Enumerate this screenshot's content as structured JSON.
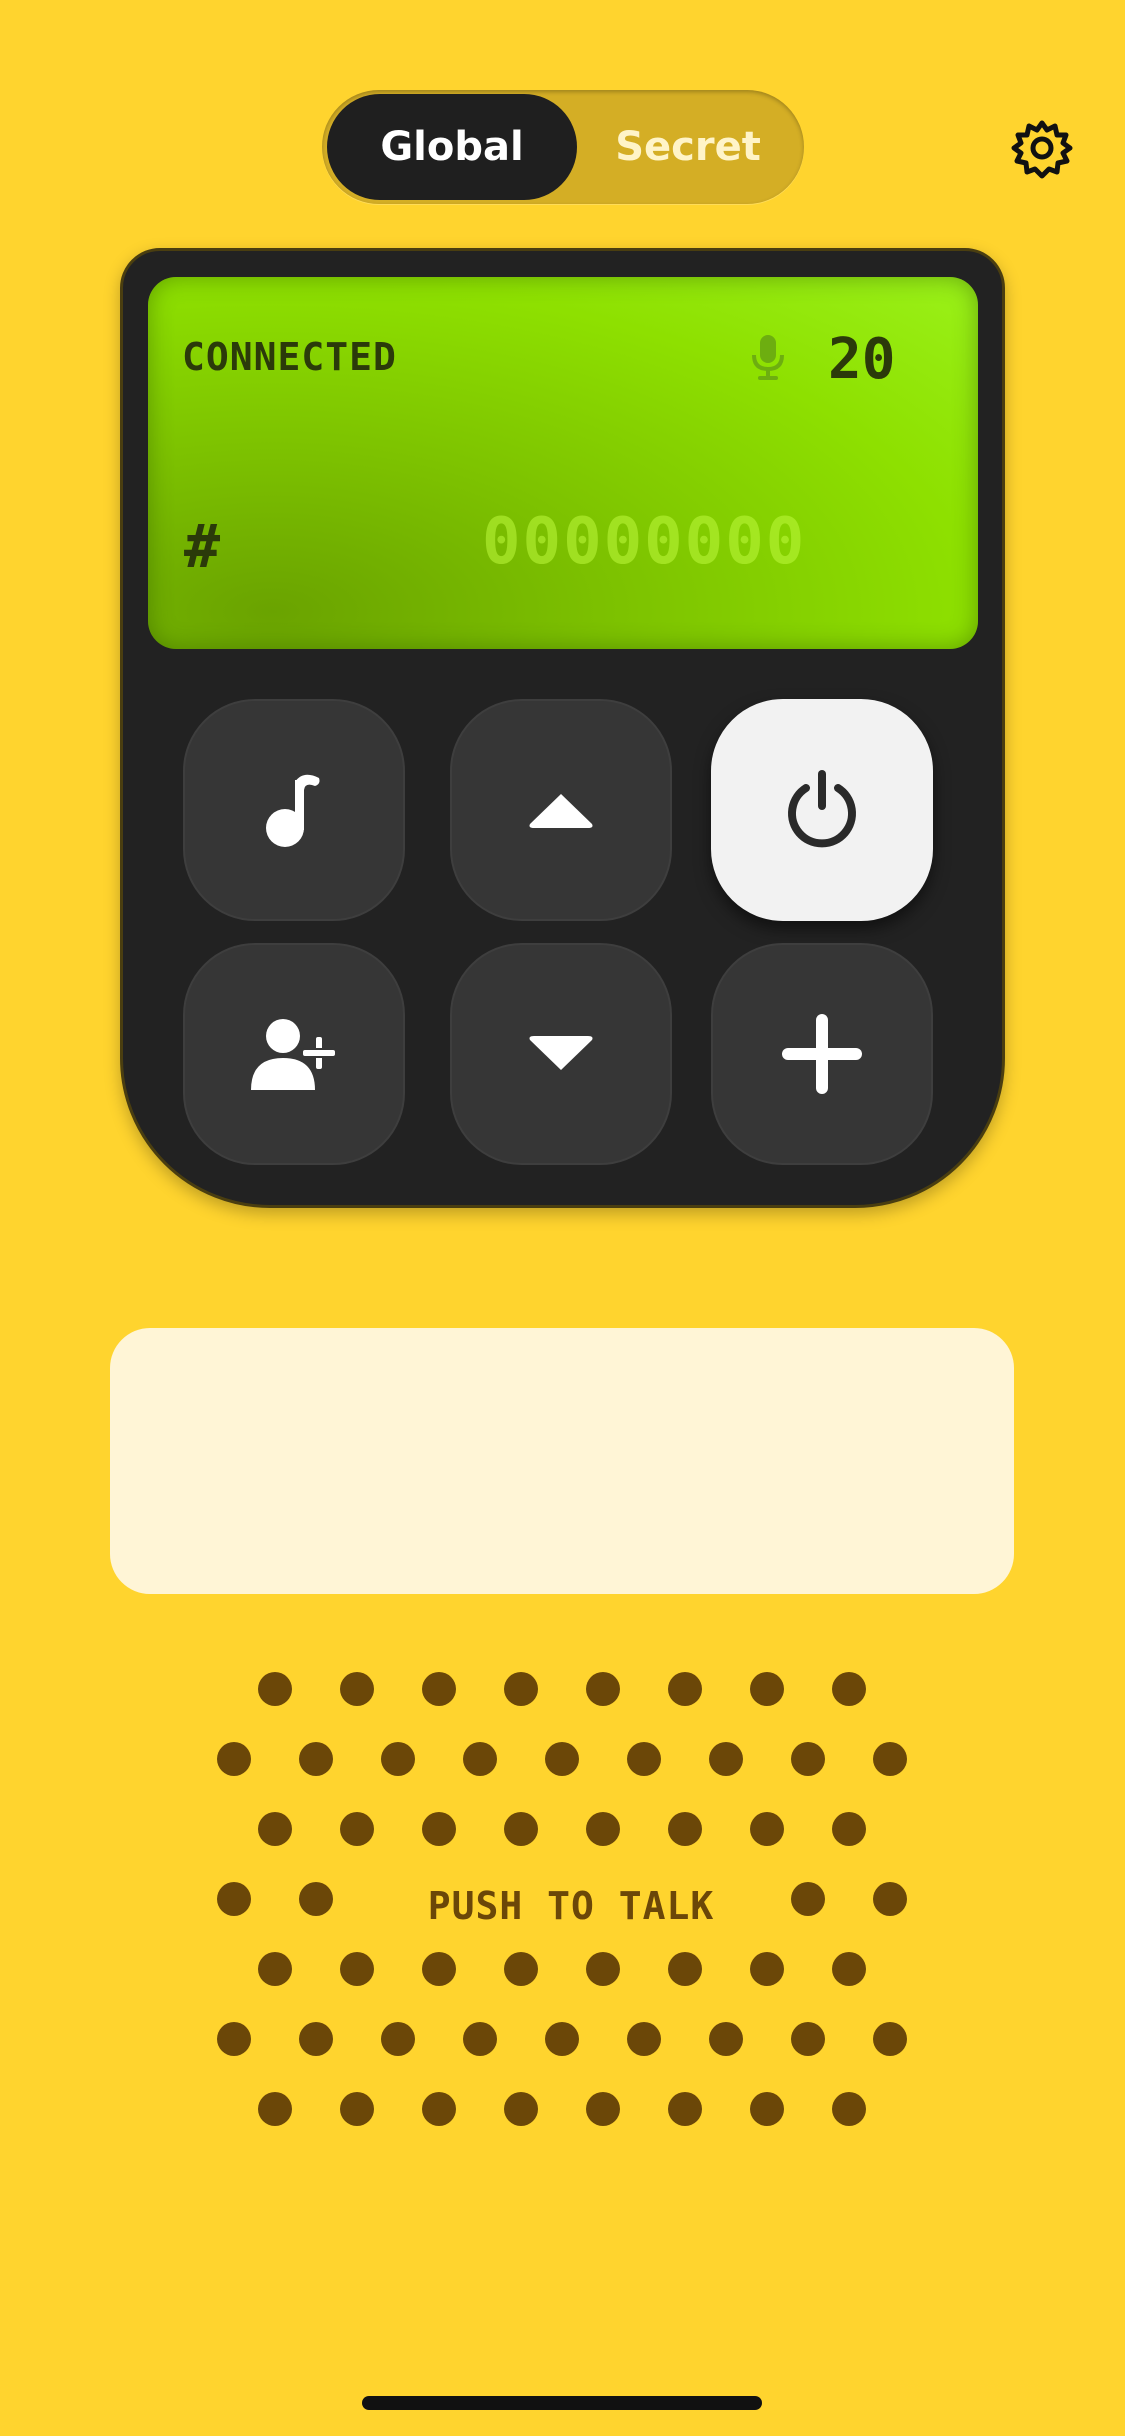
{
  "mode_toggle": {
    "options": [
      {
        "label": "Global",
        "selected": true
      },
      {
        "label": "Secret",
        "selected": false
      }
    ]
  },
  "settings": {
    "icon": "gear-icon"
  },
  "display": {
    "status": "CONNECTED",
    "mic_icon": "microphone-icon",
    "count": "20",
    "channel_prefix": "#",
    "channel_digits": "00000000"
  },
  "keypad": [
    {
      "icon": "music-note-icon"
    },
    {
      "icon": "arrow-up-icon"
    },
    {
      "icon": "power-icon"
    },
    {
      "icon": "add-user-icon"
    },
    {
      "icon": "arrow-down-icon"
    },
    {
      "icon": "plus-icon"
    }
  ],
  "message_box": {
    "text": ""
  },
  "push_to_talk": {
    "label": "PUSH TO TALK"
  },
  "colors": {
    "background": "#FFD42E",
    "device": "#222222",
    "screen": "#8EE000",
    "key": "#363636",
    "power_key": "#F2F2F2",
    "message_box": "#FFF5D6",
    "speaker_dot": "#6B4708"
  }
}
